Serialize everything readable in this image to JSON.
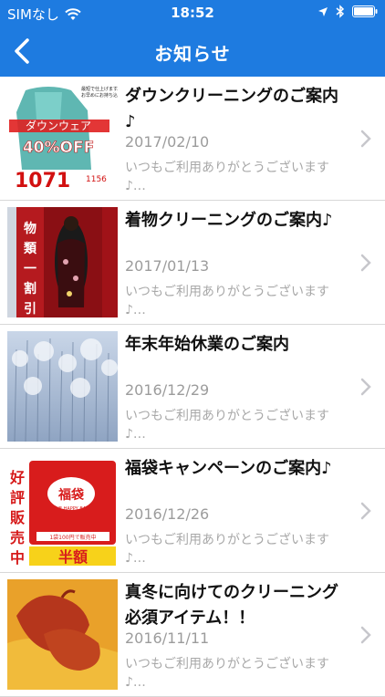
{
  "status_bar": {
    "carrier": "SIMなし",
    "time": "18:52",
    "icons": [
      "wifi-icon",
      "location-arrow-icon",
      "bluetooth-icon",
      "battery-icon"
    ]
  },
  "nav": {
    "title": "お知らせ",
    "back_icon": "chevron-left-icon"
  },
  "items": [
    {
      "title": "ダウンクリーニングのご案内♪",
      "date": "2017/02/10",
      "excerpt": "いつもご利用ありがとうございます♪…",
      "thumb_text_1": "ダウンウェア",
      "thumb_text_2": "40%OFF",
      "thumb_text_3": "1071",
      "thumb_text_4": "1156",
      "thumb_note": "最短で仕上げます。お早めにお持ち込み下さい。"
    },
    {
      "title": "着物クリーニングのご案内♪",
      "date": "2017/01/13",
      "excerpt": "いつもご利用ありがとうございます♪…",
      "thumb_text_1": "物類一割引"
    },
    {
      "title": "年末年始休業のご案内",
      "date": "2016/12/29",
      "excerpt": "いつもご利用ありがとうございます♪…"
    },
    {
      "title": "福袋キャンペーンのご案内♪",
      "date": "2016/12/26",
      "excerpt": "いつもご利用ありがとうございます♪…",
      "thumb_text_1": "好評販売中",
      "thumb_text_2": "福袋",
      "thumb_text_3": "THE HAPPY BAG",
      "thumb_text_4": "1袋100円で販売中",
      "thumb_text_5": "半額"
    },
    {
      "title": "真冬に向けてのクリーニング必須アイテム！！",
      "date": "2016/11/11",
      "excerpt": "いつもご利用ありがとうございます♪…"
    }
  ],
  "colors": {
    "accent": "#1e7be0",
    "text_secondary": "#9c9c9c",
    "divider": "#d8d8d8"
  }
}
